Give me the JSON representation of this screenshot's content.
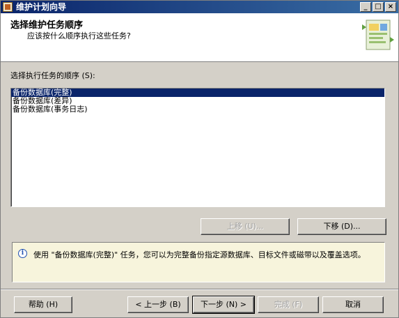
{
  "window": {
    "title": "维护计划向导",
    "controls": {
      "minimize": "_",
      "maximize": "□",
      "close": "×"
    }
  },
  "header": {
    "title": "选择维护任务顺序",
    "subtitle": "应该按什么顺序执行这些任务?"
  },
  "task_list": {
    "label": "选择执行任务的顺序 (S):",
    "items": [
      {
        "label": "备份数据库(完整)",
        "selected": true
      },
      {
        "label": "备份数据库(差异)",
        "selected": false
      },
      {
        "label": "备份数据库(事务日志)",
        "selected": false
      }
    ]
  },
  "order_buttons": {
    "move_up": "上移 (U)...",
    "move_down": "下移 (D)..."
  },
  "info": {
    "text": "使用 \"备份数据库(完整)\" 任务，您可以为完整备份指定源数据库、目标文件或磁带以及覆盖选项。"
  },
  "footer": {
    "help": "帮助 (H)",
    "back": "< 上一步 (B)",
    "next": "下一步 (N) >",
    "finish": "完成 (F)",
    "cancel": "取消"
  }
}
